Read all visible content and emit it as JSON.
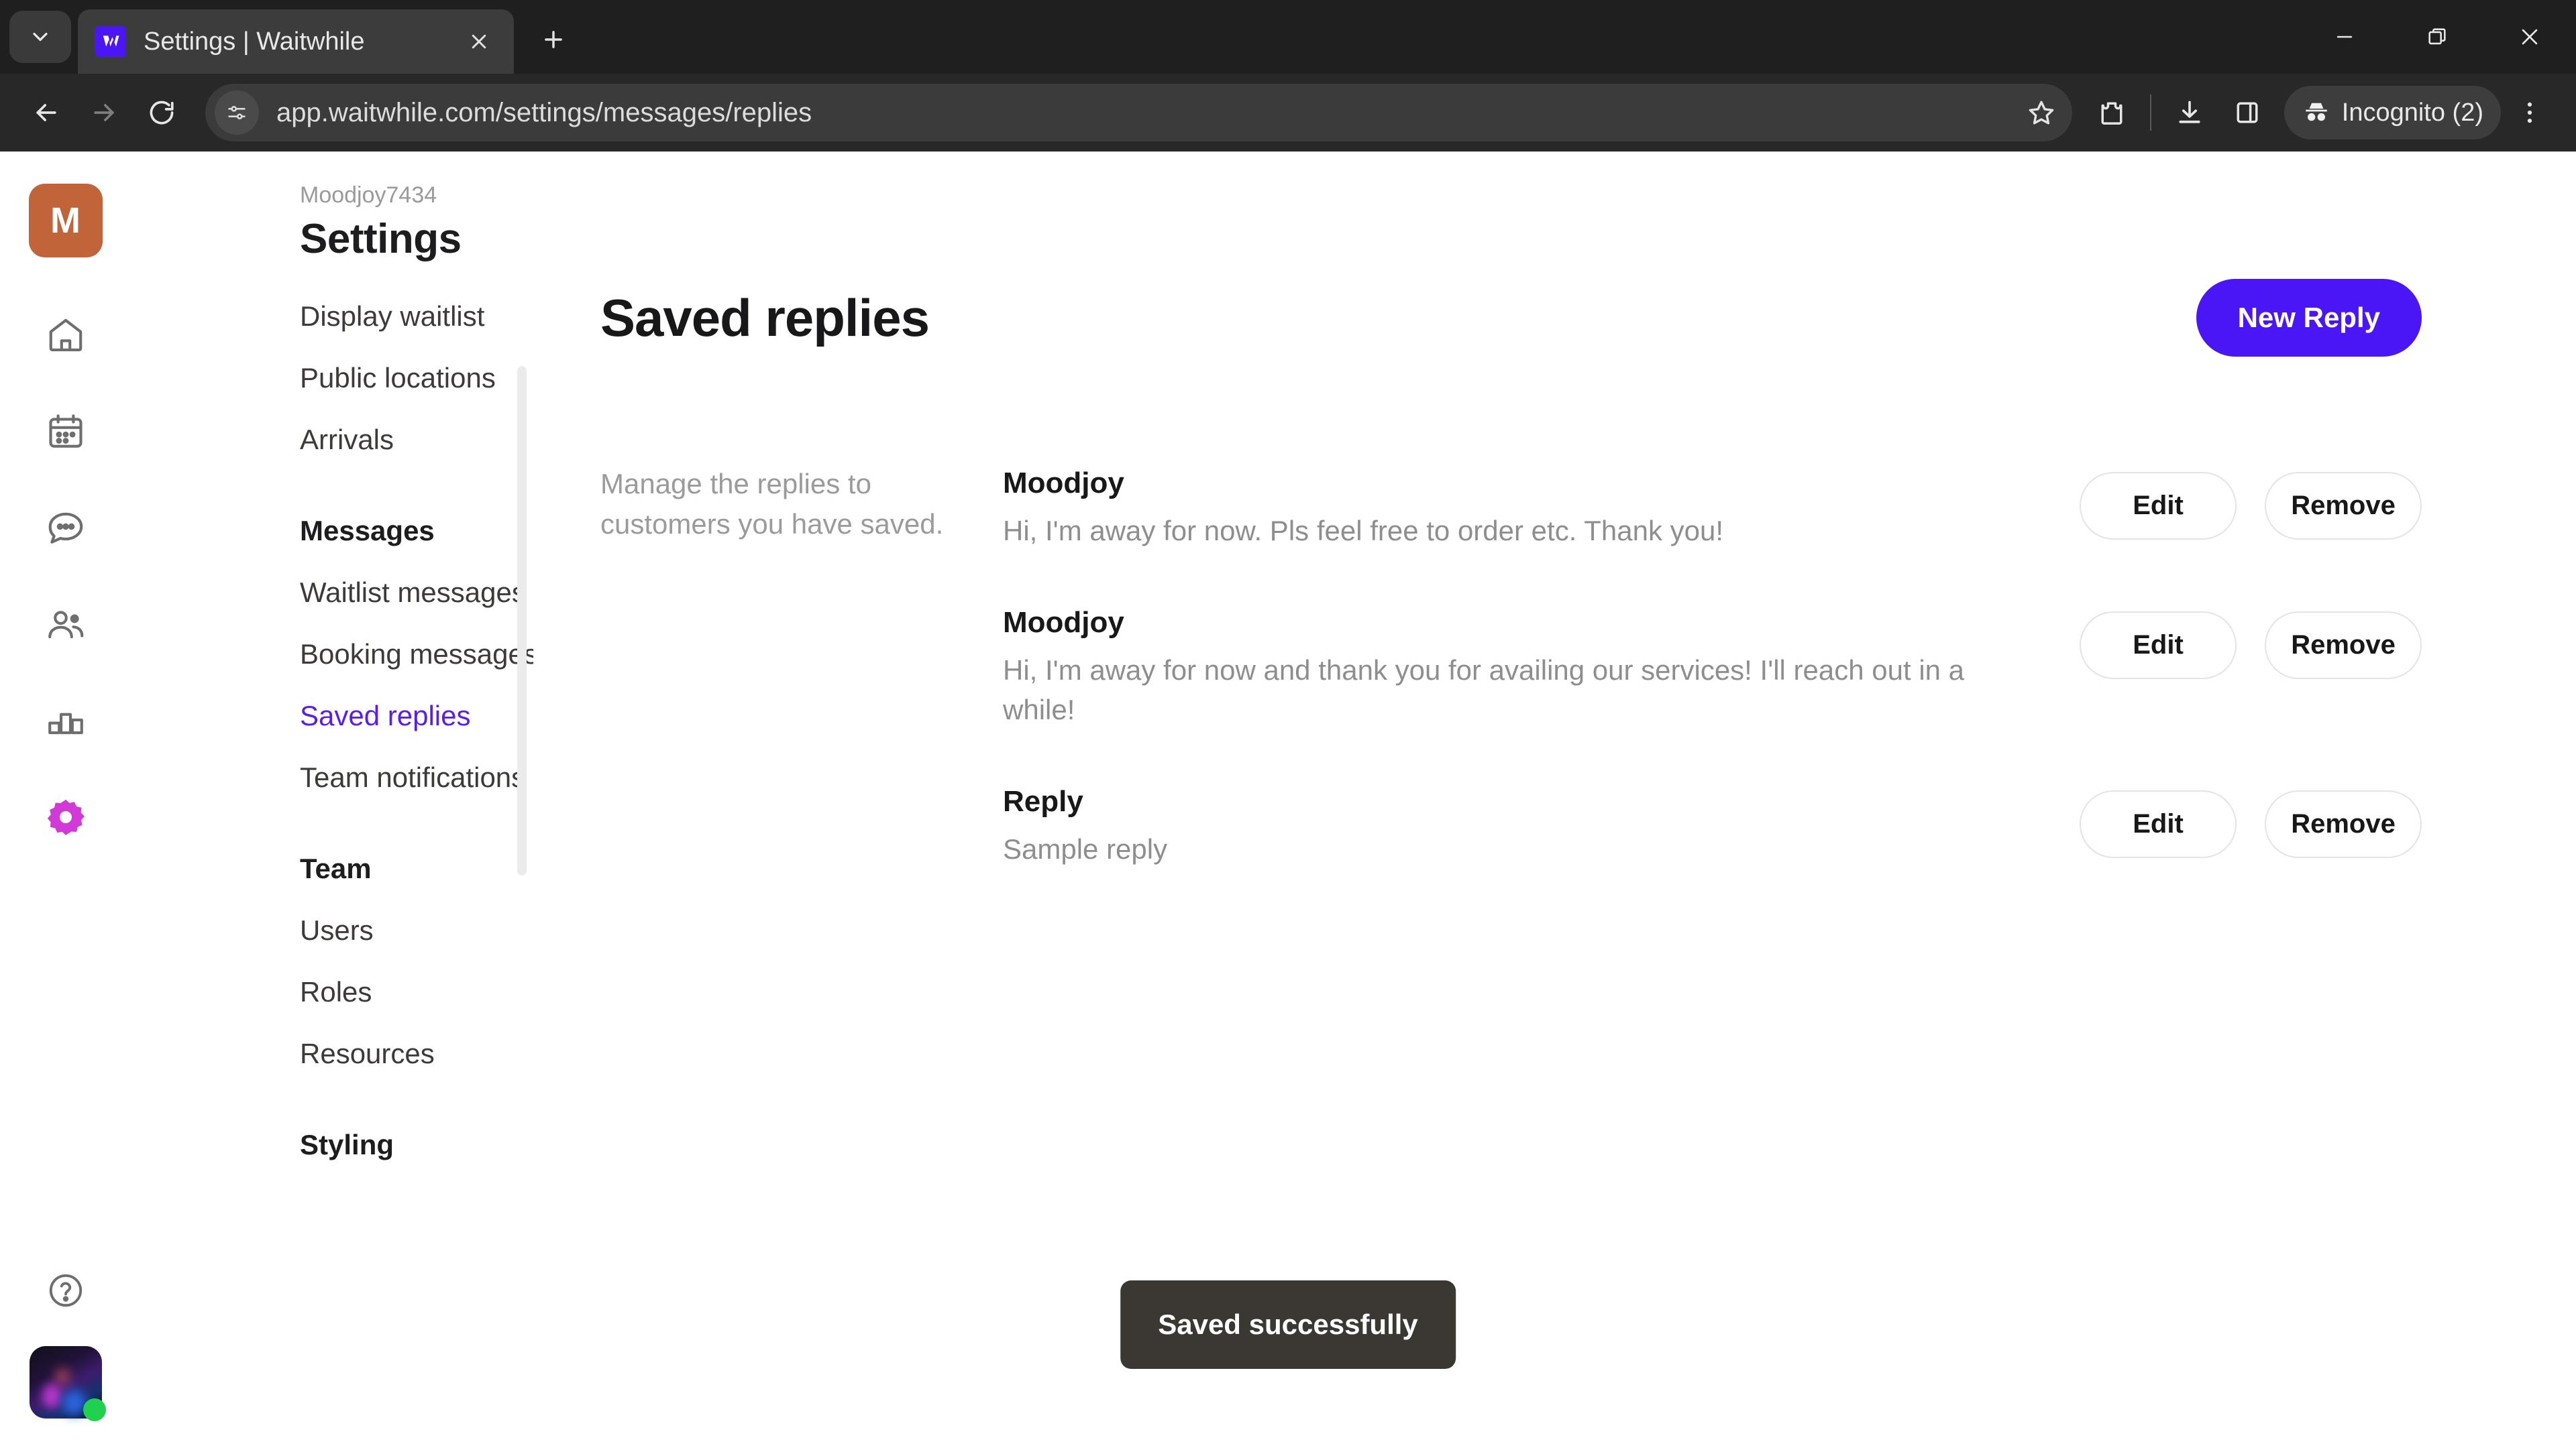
{
  "browser": {
    "tab": {
      "title": "Settings | Waitwhile",
      "favicon": "waitwhile-logo-icon"
    },
    "new_tab_label": "+",
    "url": "app.waitwhile.com/settings/messages/replies",
    "profile_label": "Incognito (2)",
    "window_controls": {
      "minimize": "minimize-icon",
      "restore": "restore-icon",
      "close": "close-icon"
    },
    "toolbar_icons": [
      "back-icon",
      "forward-icon",
      "reload-icon",
      "site-settings-icon",
      "bookmark-star-icon",
      "extensions-icon",
      "downloads-icon",
      "side-panel-icon",
      "incognito-icon",
      "browser-menu-icon"
    ]
  },
  "rail": {
    "logo_letter": "M",
    "logo_color": "#c1643a",
    "items": [
      {
        "icon": "home-icon",
        "active": false
      },
      {
        "icon": "calendar-icon",
        "active": false
      },
      {
        "icon": "chat-bubble-icon",
        "active": false
      },
      {
        "icon": "people-icon",
        "active": false
      },
      {
        "icon": "bar-chart-icon",
        "active": false
      },
      {
        "icon": "gear-icon",
        "active": true
      }
    ],
    "active_color": "#d13ad6",
    "help_icon": "help-circle-icon",
    "avatar": "user-avatar",
    "status": "online"
  },
  "settings_nav": {
    "org_name": "Moodjoy7434",
    "heading": "Settings",
    "items": [
      {
        "label": "Display waitlist",
        "type": "link",
        "active": false
      },
      {
        "label": "Public locations",
        "type": "link",
        "active": false
      },
      {
        "label": "Arrivals",
        "type": "link",
        "active": false
      },
      {
        "label": "Messages",
        "type": "group"
      },
      {
        "label": "Waitlist messages",
        "type": "link",
        "active": false
      },
      {
        "label": "Booking messages",
        "type": "link",
        "active": false
      },
      {
        "label": "Saved replies",
        "type": "link",
        "active": true
      },
      {
        "label": "Team notifications",
        "type": "link",
        "active": false
      },
      {
        "label": "Team",
        "type": "group"
      },
      {
        "label": "Users",
        "type": "link",
        "active": false
      },
      {
        "label": "Roles",
        "type": "link",
        "active": false
      },
      {
        "label": "Resources",
        "type": "link",
        "active": false
      },
      {
        "label": "Styling",
        "type": "group"
      }
    ],
    "active_color": "#5b1cf0"
  },
  "main": {
    "title": "Saved replies",
    "new_reply_label": "New Reply",
    "new_reply_color": "#4b16f5",
    "description": "Manage the replies to customers you have saved.",
    "edit_label": "Edit",
    "remove_label": "Remove",
    "replies": [
      {
        "title": "Moodjoy",
        "body": "Hi, I'm away for now. Pls feel free to order etc. Thank you!"
      },
      {
        "title": "Moodjoy",
        "body": "Hi, I'm away for now and thank you for availing our services! I'll reach out in a while!"
      },
      {
        "title": "Reply",
        "body": "Sample reply"
      }
    ]
  },
  "toast": {
    "message": "Saved successfully"
  }
}
